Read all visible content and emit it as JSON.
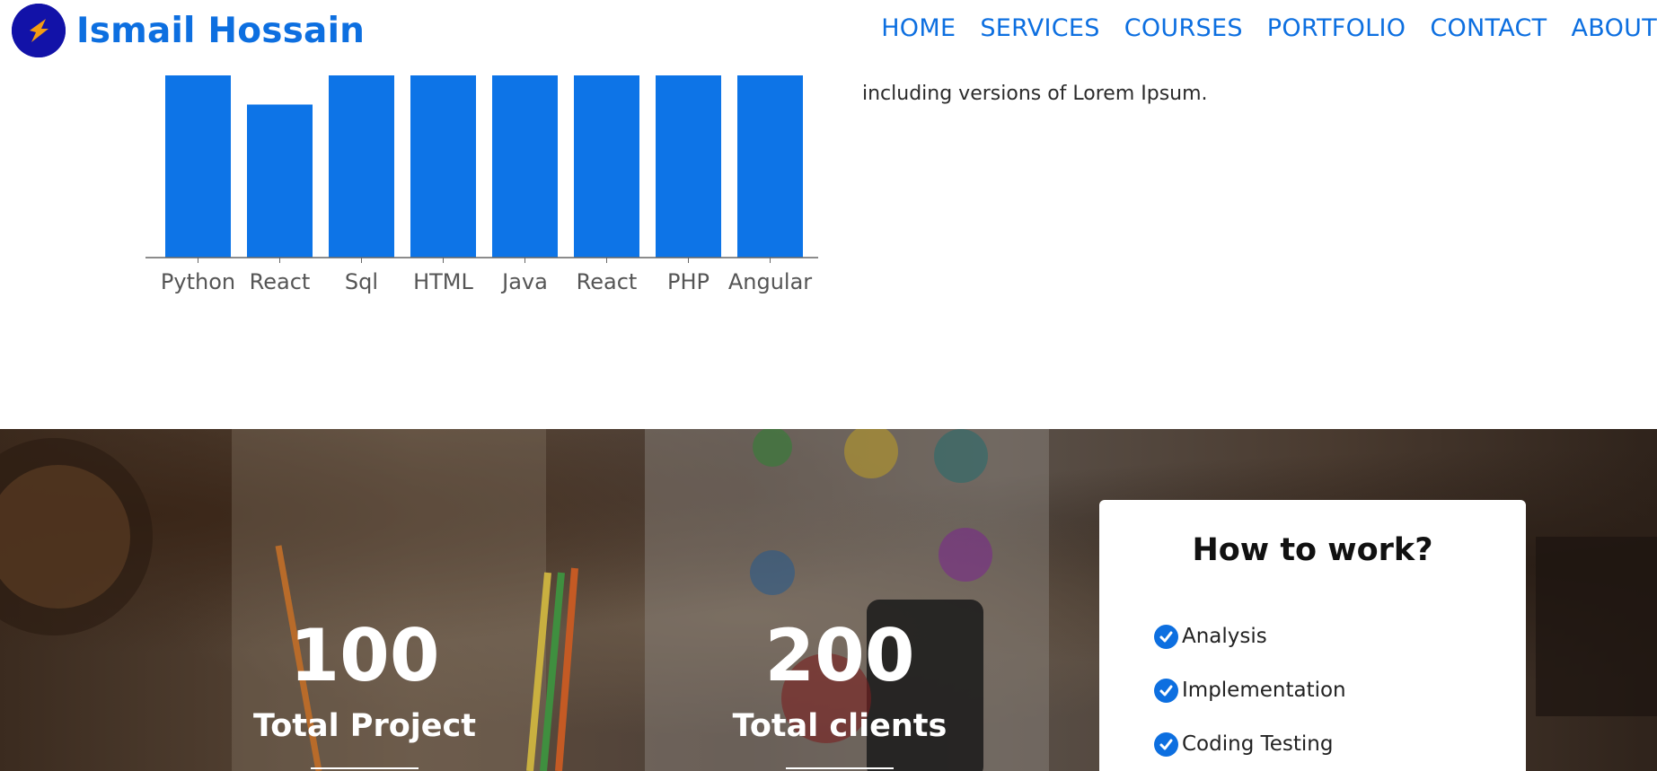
{
  "header": {
    "brand_name": "Ismail Hossain",
    "nav": [
      "HOME",
      "SERVICES",
      "COURSES",
      "PORTFOLIO",
      "CONTACT",
      "ABOUT"
    ]
  },
  "paragraph": {
    "visible_line": "including versions of Lorem Ipsum."
  },
  "chart_data": {
    "type": "bar",
    "categories": [
      "Python",
      "React",
      "Sql",
      "HTML",
      "Java",
      "React",
      "PHP",
      "Angular"
    ],
    "values": [
      100,
      84,
      100,
      100,
      100,
      100,
      100,
      100
    ],
    "ylim": [
      0,
      100
    ],
    "color": "#0d74e7"
  },
  "stats": [
    {
      "number": "100",
      "label": "Total Project"
    },
    {
      "number": "200",
      "label": "Total clients"
    }
  ],
  "how_to_work": {
    "title": "How to work?",
    "items": [
      "Analysis",
      "Implementation",
      "Coding Testing"
    ],
    "check_icon": "check-circle-icon"
  },
  "colors": {
    "brand": "#0d6fe0",
    "logo_bg": "#1212a8",
    "logo_accent": "#f39c12"
  }
}
